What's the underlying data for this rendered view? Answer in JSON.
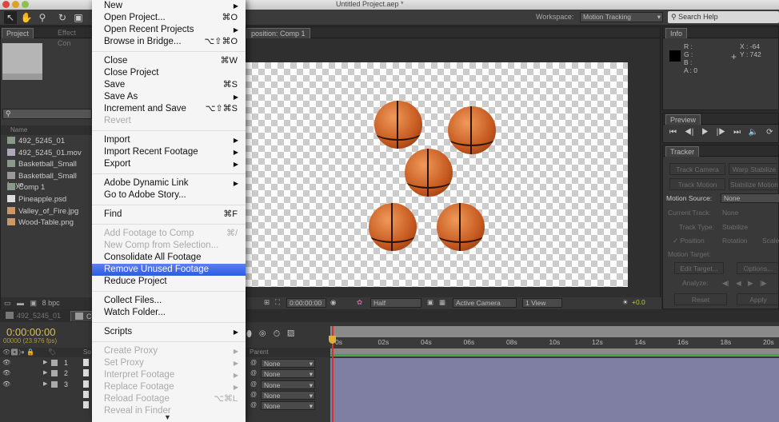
{
  "window": {
    "title": "Untitled Project.aep *"
  },
  "toolbar": {
    "workspace_label": "Workspace:",
    "workspace_value": "Motion Tracking",
    "search_placeholder": "Search Help"
  },
  "project_panel": {
    "tabs": [
      "Project",
      "Effect Con"
    ],
    "column_name": "Name",
    "items": [
      {
        "name": "492_5245_01",
        "icon": "composition-icon"
      },
      {
        "name": "492_5245_01.mov",
        "icon": "movie-file-icon"
      },
      {
        "name": "Basketball_Small",
        "icon": "composition-icon"
      },
      {
        "name": "Basketball_Small Laye",
        "icon": "folder-icon"
      },
      {
        "name": "Comp 1",
        "icon": "composition-icon"
      },
      {
        "name": "Pineapple.psd",
        "icon": "psd-file-icon"
      },
      {
        "name": "Valley_of_Fire.jpg",
        "icon": "image-file-icon"
      },
      {
        "name": "Wood-Table.png",
        "icon": "image-file-icon"
      }
    ],
    "bpc": "8 bpc"
  },
  "comp_viewer": {
    "tab": "position: Comp 1",
    "timecode": "0:00:00:00",
    "resolution": "Half",
    "camera": "Active Camera",
    "views": "1 View",
    "exposure": "+0.0"
  },
  "file_menu": [
    {
      "label": "New",
      "submenu": true
    },
    {
      "label": "Open Project...",
      "shortcut": "⌘O"
    },
    {
      "label": "Open Recent Projects",
      "submenu": true
    },
    {
      "label": "Browse in Bridge...",
      "shortcut": "⌥⇧⌘O"
    },
    {
      "separator": true
    },
    {
      "label": "Close",
      "shortcut": "⌘W"
    },
    {
      "label": "Close Project"
    },
    {
      "label": "Save",
      "shortcut": "⌘S"
    },
    {
      "label": "Save As",
      "submenu": true
    },
    {
      "label": "Increment and Save",
      "shortcut": "⌥⇧⌘S"
    },
    {
      "label": "Revert",
      "disabled": true
    },
    {
      "separator": true
    },
    {
      "label": "Import",
      "submenu": true
    },
    {
      "label": "Import Recent Footage",
      "submenu": true
    },
    {
      "label": "Export",
      "submenu": true
    },
    {
      "separator": true
    },
    {
      "label": "Adobe Dynamic Link",
      "submenu": true
    },
    {
      "label": "Go to Adobe Story..."
    },
    {
      "separator": true
    },
    {
      "label": "Find",
      "shortcut": "⌘F"
    },
    {
      "separator": true
    },
    {
      "label": "Add Footage to Comp",
      "shortcut": "⌘/",
      "disabled": true
    },
    {
      "label": "New Comp from Selection...",
      "disabled": true
    },
    {
      "label": "Consolidate All Footage"
    },
    {
      "label": "Remove Unused Footage",
      "highlighted": true
    },
    {
      "label": "Reduce Project"
    },
    {
      "separator": true
    },
    {
      "label": "Collect Files..."
    },
    {
      "label": "Watch Folder..."
    },
    {
      "separator": true
    },
    {
      "label": "Scripts",
      "submenu": true
    },
    {
      "separator": true
    },
    {
      "label": "Create Proxy",
      "submenu": true,
      "disabled": true
    },
    {
      "label": "Set Proxy",
      "submenu": true,
      "disabled": true
    },
    {
      "label": "Interpret Footage",
      "submenu": true,
      "disabled": true
    },
    {
      "label": "Replace Footage",
      "submenu": true,
      "disabled": true
    },
    {
      "label": "Reload Footage",
      "shortcut": "⌥⌘L",
      "disabled": true
    },
    {
      "label": "Reveal in Finder",
      "disabled": true
    }
  ],
  "info": {
    "tab": "Info",
    "r": "R :",
    "g": "G :",
    "b": "B :",
    "a": "A : 0",
    "x": "X : -64",
    "y": "Y : 742"
  },
  "preview": {
    "tab": "Preview"
  },
  "tracker": {
    "tab": "Tracker",
    "track_camera": "Track Camera",
    "warp_stabilize": "Warp Stabilize",
    "track_motion": "Track Motion",
    "stabilize_motion": "Stabilize Motion",
    "motion_source_label": "Motion Source:",
    "motion_source": "None",
    "current_track_label": "Current Track:",
    "current_track": "None",
    "track_type_label": "Track Type:",
    "track_type": "Stabilize",
    "position": "✓ Position",
    "rotation": "Rotation",
    "scale": "Scale",
    "motion_target_label": "Motion Target:",
    "edit_target": "Edit Target...",
    "options": "Options...",
    "analyze_label": "Analyze:",
    "reset": "Reset",
    "apply": "Apply"
  },
  "timeline": {
    "tabs": [
      "492_5245_01",
      "Co"
    ],
    "timecode": "0:00:00:00",
    "fps": "00000 (23.976 fps)",
    "col_source": "So",
    "col_parent": "Parent",
    "layers": [
      "1",
      "2",
      "3"
    ],
    "parents": [
      "None",
      "None",
      "None",
      "None",
      "None"
    ],
    "ruler": [
      "0s",
      "02s",
      "04s",
      "06s",
      "08s",
      "10s",
      "12s",
      "14s",
      "16s",
      "18s",
      "20s"
    ]
  }
}
